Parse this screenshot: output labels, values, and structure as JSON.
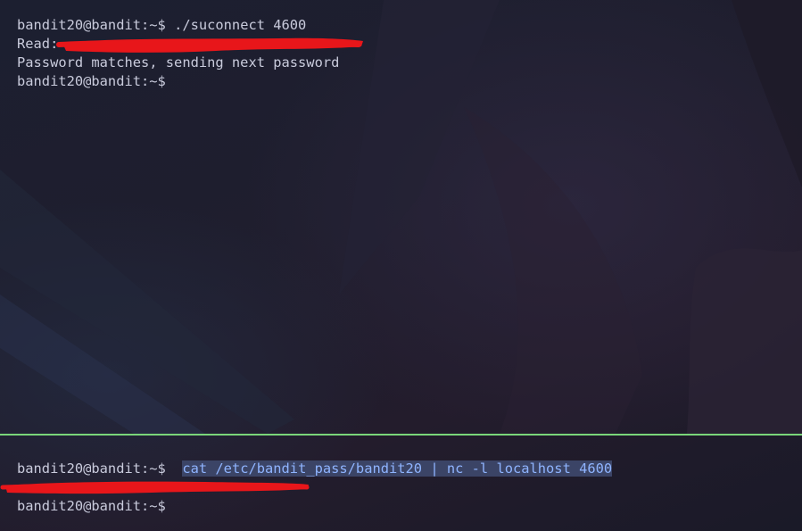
{
  "top_pane": {
    "lines": [
      {
        "prompt": "bandit20@bandit:~$",
        "command": " ./suconnect 4600"
      },
      {
        "text": "Read:"
      },
      {
        "text": "Password matches, sending next password"
      },
      {
        "prompt": "bandit20@bandit:~$",
        "command": ""
      }
    ]
  },
  "bottom_pane": {
    "lines": [
      {
        "prompt": "bandit20@bandit:~$",
        "command": "cat /etc/bandit_pass/bandit20 | nc -l localhost 4600"
      },
      {
        "text": ""
      },
      {
        "prompt": "bandit20@bandit:~$",
        "command": ""
      }
    ]
  },
  "colors": {
    "divider": "#7ad67a",
    "redaction": "#e8161a",
    "selection_bg": "#3b4466",
    "selection_fg": "#8fb4ff"
  }
}
